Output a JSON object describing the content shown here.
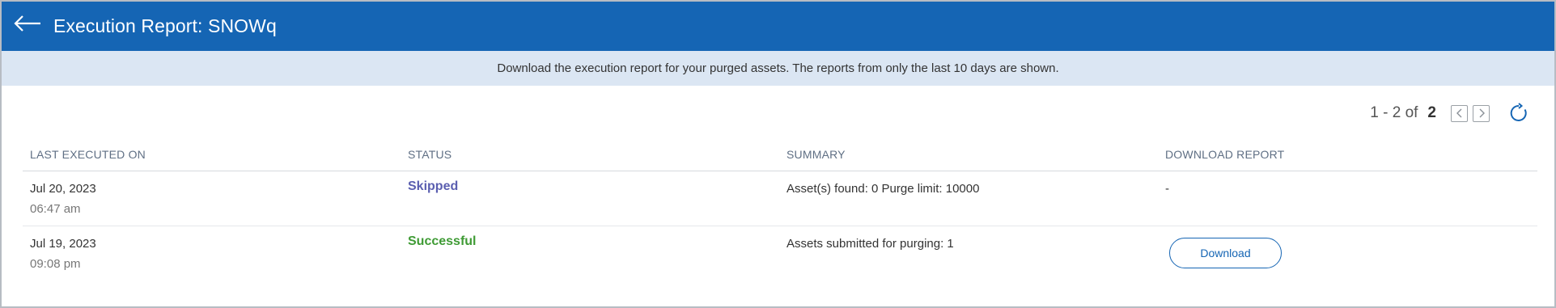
{
  "header": {
    "title": "Execution Report: SNOWq",
    "back_icon": "arrow-left-icon"
  },
  "banner": {
    "text": "Download the execution report for your purged assets. The reports from only the last 10 days are shown."
  },
  "pagination": {
    "range": "1 - 2 of",
    "total": "2",
    "prev_icon": "chevron-left-icon",
    "next_icon": "chevron-right-icon",
    "refresh_icon": "refresh-icon"
  },
  "table": {
    "columns": [
      "LAST EXECUTED ON",
      "STATUS",
      "SUMMARY",
      "DOWNLOAD REPORT"
    ],
    "rows": [
      {
        "date": "Jul 20, 2023",
        "time": "06:47 am",
        "status": "Skipped",
        "status_color": "#5b5fb0",
        "summary": "Asset(s) found: 0 Purge limit: 10000",
        "download": "-"
      },
      {
        "date": "Jul 19, 2023",
        "time": "09:08 pm",
        "status": "Successful",
        "status_color": "#3f9b35",
        "summary": "Assets submitted for purging: 1",
        "download": "Download"
      }
    ]
  },
  "colors": {
    "header_bg": "#1565b4",
    "banner_bg": "#dbe6f3",
    "accent": "#1565b4"
  }
}
